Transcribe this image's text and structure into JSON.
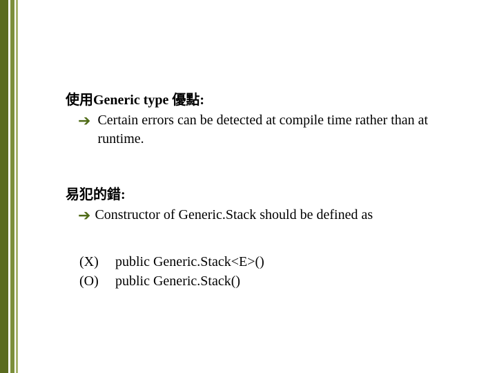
{
  "section1": {
    "heading": "使用Generic type 優點:",
    "bullet": "Certain errors can be detected at compile time rather than at runtime."
  },
  "section2": {
    "heading": "易犯的錯:",
    "bullet": "Constructor of Generic.Stack should be defined as"
  },
  "examples": {
    "wrong": {
      "mark": "(X)",
      "code": "public Generic.Stack<E>()"
    },
    "right": {
      "mark": "(O)",
      "code": "public Generic.Stack()"
    }
  }
}
